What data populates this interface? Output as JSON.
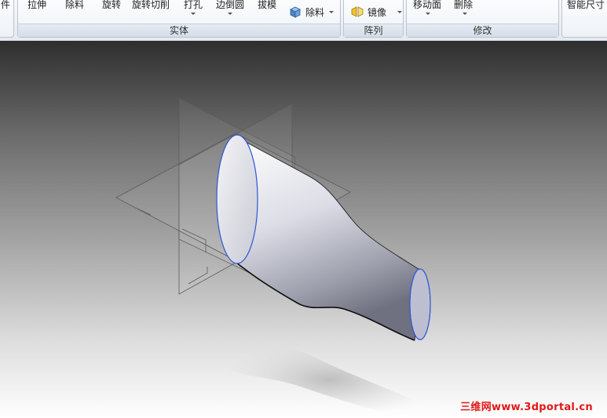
{
  "ribbon": {
    "left_fragment": "件",
    "solid_group": {
      "label": "实体",
      "tools": [
        "拉伸",
        "除料",
        "旋转",
        "旋转切削",
        "打孔",
        "边倒圆",
        "拔模"
      ],
      "cut_button": "除料"
    },
    "pattern_group": {
      "label": "阵列",
      "mirror_button": "镜像"
    },
    "modify_group": {
      "label": "修改",
      "tools": [
        "移动面",
        "删除"
      ]
    },
    "right_fragment": "智能尺寸"
  },
  "watermark": "三维网www.3dportal.cn",
  "colors": {
    "ribbon_bg": "#eef2f7",
    "edge_highlight": "#2f56d6",
    "watermark": "#e01818"
  }
}
